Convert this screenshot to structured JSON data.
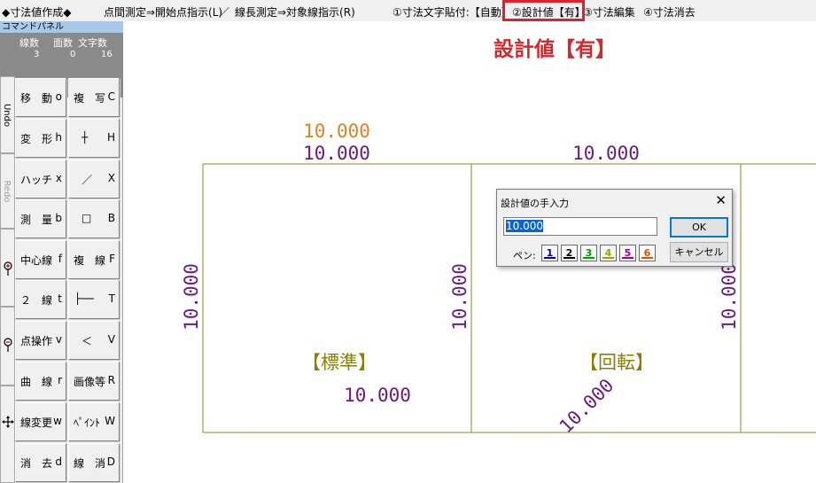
{
  "topbar": {
    "mode": "◆寸法値作成◆",
    "point_measure": "点間測定⇒開始点指示(L)",
    "slash": "／",
    "line_measure": "線長測定⇒対象線指示(R)",
    "step1": "①寸法文字貼付:【自動】",
    "step2": "②設計値【有】",
    "step3": "③寸法編集",
    "step4": "④寸法消去"
  },
  "panel": {
    "title": "コマンドパネル",
    "stats_labels": [
      "線数",
      "面数",
      "文字数"
    ],
    "stats_values": [
      "3",
      "0",
      "16"
    ],
    "side": {
      "undo": "Undo",
      "redo": "Redo"
    },
    "buttons_left": [
      {
        "label": "移　動",
        "key": "o"
      },
      {
        "label": "変　形",
        "key": "h"
      },
      {
        "label": "ハッチ",
        "key": "x"
      },
      {
        "label": "測　量",
        "key": "b"
      },
      {
        "label": "中心線",
        "key": "f"
      },
      {
        "label": "２　線",
        "key": "t"
      },
      {
        "label": "点操作",
        "key": "v"
      },
      {
        "label": "曲　線",
        "key": "r"
      },
      {
        "label": "線変更",
        "key": "w"
      },
      {
        "label": "消　去",
        "key": "d"
      }
    ],
    "buttons_right": [
      {
        "label": "複　写",
        "key": "C"
      },
      {
        "label": "┼",
        "key": "H"
      },
      {
        "label": "／",
        "key": "X"
      },
      {
        "label": "□",
        "key": "B"
      },
      {
        "label": "複　線",
        "key": "F"
      },
      {
        "label": "├──",
        "key": "T"
      },
      {
        "label": "＜",
        "key": "V"
      },
      {
        "label": "画像等",
        "key": "R"
      },
      {
        "label": "ﾍﾟｲﾝﾄ",
        "key": "W"
      },
      {
        "label": "線　消",
        "key": "D"
      }
    ]
  },
  "canvas": {
    "heading": "設計値【有】",
    "dim_design_top": "10.000",
    "dim_top_left": "10.000",
    "dim_top_right": "10.000",
    "dim_left_vertical": "10.000",
    "dim_mid_vertical": "10.000",
    "dim_right_vertical": "10.000",
    "label_standard": "【標準】",
    "label_rotate": "【回転】",
    "dim_bottom_left": "10.000",
    "dim_bottom_rotated": "10.000"
  },
  "dialog": {
    "title": "設計値の手入力",
    "close": "✕",
    "input_value": "10.000",
    "ok": "OK",
    "cancel": "キャンセル",
    "pen_label": "ペン:",
    "pens": [
      "1",
      "2",
      "3",
      "4",
      "5",
      "6"
    ]
  },
  "colors": {
    "dimension_purple": "#6a1a80",
    "design_orange": "#d98324",
    "label_olive": "#8a8000",
    "heading_red": "#d4282c",
    "frame_olive": "#8a8a20",
    "pen_colors": [
      "#0000c0",
      "#000000",
      "#00a000",
      "#a0a000",
      "#a000a0",
      "#e05000"
    ]
  }
}
